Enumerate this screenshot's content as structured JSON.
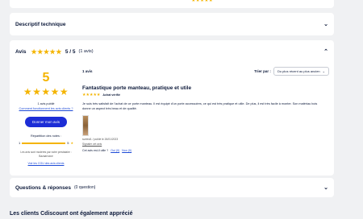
{
  "top_strip": {
    "stars": "★★★★★"
  },
  "descriptif": {
    "title": "Descriptif technique"
  },
  "avis": {
    "title": "Avis",
    "stars": "★★★★★",
    "score": "5 / 5",
    "count": "(1 avis)",
    "summary": {
      "big_score": "5",
      "big_stars": "★★★★★",
      "reviews_count": "1 avis publié",
      "how_link": "Comment fonctionnent les avis clients ?",
      "button": "Donner mon avis",
      "repartition_title": "Répartition des notes :",
      "rep_count": "1",
      "rep_label": "5",
      "rep_star": "★",
      "moderation_note": "Les avis sont modérés par notre prestataire : Bazaarvoice",
      "cgu_link": "Voir les CGU des avis clients"
    },
    "list": {
      "nb": "1 avis",
      "sort_label": "Trier par :",
      "sort_value": "Du plus récent au plus ancien"
    },
    "review": {
      "title": "Fantastique porte manteau, pratique et utile",
      "stars": "★★★★★",
      "verified": "Achat vérifié",
      "text": "Je suis très satisfait de l'achat de ce porte manteau. Il est équipé d'un porte accessoires, ce qui est très pratique et utile. De plus, il est très facile à monter. Son matériau bois donne un aspect très beau et de qualité.",
      "author": "surtest1 / publié le 26/01/2023",
      "report": "Signaler cet avis",
      "helpful": "Cet avis est-il utile ?",
      "yes": "Oui (0)",
      "no": "Non (0)"
    }
  },
  "questions": {
    "title": "Questions & réponses",
    "count": "(0 question)"
  },
  "bottom_title": "Les clients Cdiscount ont également apprécié"
}
